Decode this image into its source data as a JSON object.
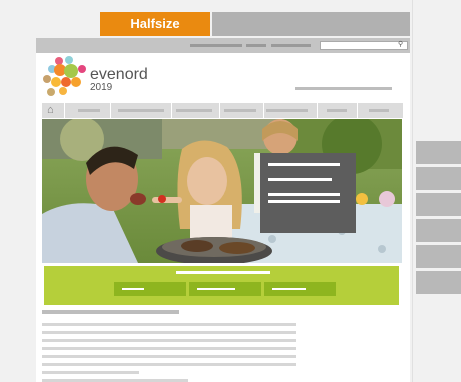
{
  "tabs": {
    "active_label": "Halfsize"
  },
  "search": {
    "icon": "magnifier-icon"
  },
  "brand": {
    "name": "evenord",
    "year": "2019"
  },
  "nav": {
    "home_icon": "house-icon"
  },
  "colors": {
    "accent": "#ea8a10",
    "green_band": "#b5cf3a",
    "green_button": "#8eb51f",
    "overlay": "#5d5d5d"
  }
}
